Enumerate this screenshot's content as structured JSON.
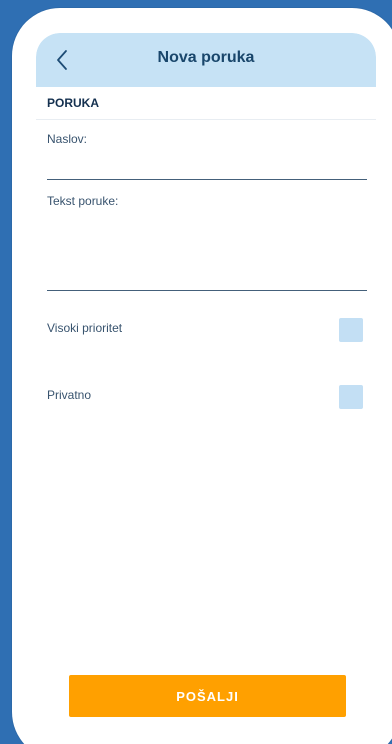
{
  "header": {
    "title": "Nova poruka",
    "back_icon": "chevron-left-icon"
  },
  "message_section": {
    "title": "PORUKA",
    "subject": {
      "label": "Naslov:",
      "value": ""
    },
    "body": {
      "label": "Tekst poruke:",
      "value": ""
    }
  },
  "options": {
    "high_priority": {
      "label": "Visoki prioritet",
      "checked": false
    },
    "private": {
      "label": "Privatno",
      "checked": false
    }
  },
  "actions": {
    "send_label": "POŠALJI"
  },
  "colors": {
    "page_background": "#2f6fb3",
    "header_background": "#c6e2f5",
    "title_text": "#19466b",
    "checkbox": "#c3dff4",
    "send_button": "#ffa000"
  }
}
